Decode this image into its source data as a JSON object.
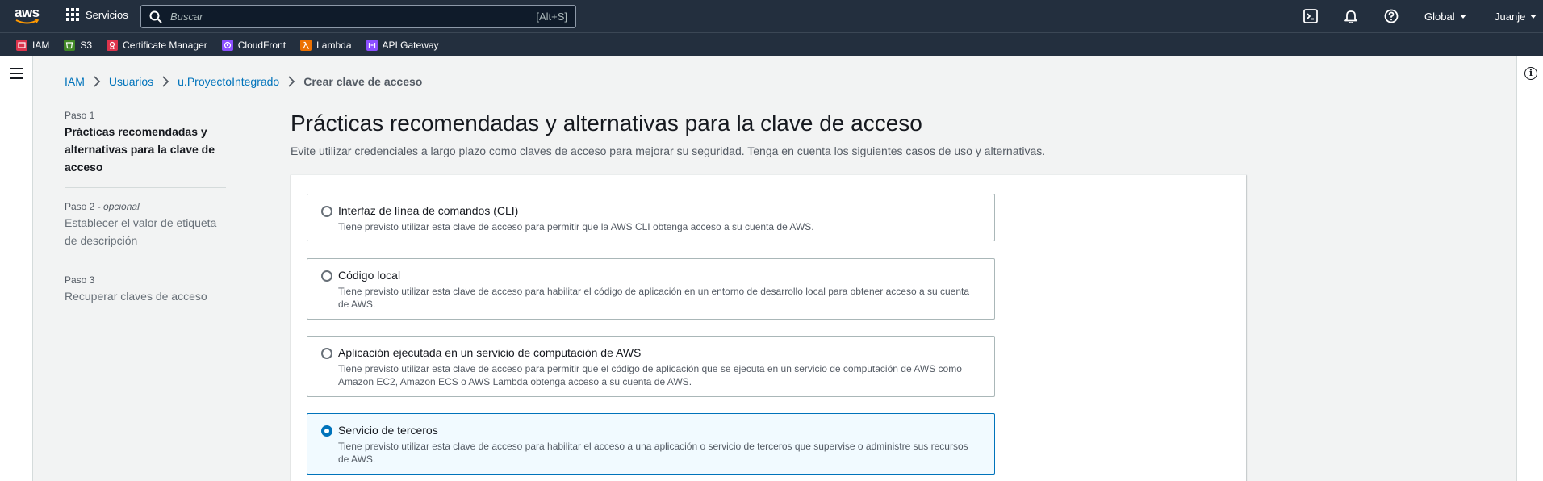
{
  "topnav": {
    "logo": "aws",
    "services_label": "Servicios",
    "search_placeholder": "Buscar",
    "search_shortcut": "[Alt+S]",
    "region": "Global",
    "user": "Juanje"
  },
  "favorites": [
    {
      "label": "IAM",
      "color": "#dd344c"
    },
    {
      "label": "S3",
      "color": "#3f8624"
    },
    {
      "label": "Certificate Manager",
      "color": "#dd344c"
    },
    {
      "label": "CloudFront",
      "color": "#8c4fff"
    },
    {
      "label": "Lambda",
      "color": "#ed7100"
    },
    {
      "label": "API Gateway",
      "color": "#8c4fff"
    }
  ],
  "breadcrumb": {
    "items": [
      "IAM",
      "Usuarios",
      "u.ProyectoIntegrado"
    ],
    "current": "Crear clave de acceso"
  },
  "steps": [
    {
      "label": "Paso 1",
      "optional": "",
      "title": "Prácticas recomendadas y alternativas para la clave de acceso"
    },
    {
      "label": "Paso 2 - ",
      "optional": "opcional",
      "title": "Establecer el valor de etiqueta de descripción"
    },
    {
      "label": "Paso 3",
      "optional": "",
      "title": "Recuperar claves de acceso"
    }
  ],
  "page": {
    "title": "Prácticas recomendadas y alternativas para la clave de acceso",
    "description": "Evite utilizar credenciales a largo plazo como claves de acceso para mejorar su seguridad. Tenga en cuenta los siguientes casos de uso y alternativas."
  },
  "options": [
    {
      "title": "Interfaz de línea de comandos (CLI)",
      "desc": "Tiene previsto utilizar esta clave de acceso para permitir que la AWS CLI obtenga acceso a su cuenta de AWS.",
      "selected": false
    },
    {
      "title": "Código local",
      "desc": "Tiene previsto utilizar esta clave de acceso para habilitar el código de aplicación en un entorno de desarrollo local para obtener acceso a su cuenta de AWS.",
      "selected": false
    },
    {
      "title": "Aplicación ejecutada en un servicio de computación de AWS",
      "desc": "Tiene previsto utilizar esta clave de acceso para permitir que el código de aplicación que se ejecuta en un servicio de computación de AWS como Amazon EC2, Amazon ECS o AWS Lambda obtenga acceso a su cuenta de AWS.",
      "selected": false
    },
    {
      "title": "Servicio de terceros",
      "desc": "Tiene previsto utilizar esta clave de acceso para habilitar el acceso a una aplicación o servicio de terceros que supervise o administre sus recursos de AWS.",
      "selected": true
    }
  ],
  "colors": {
    "nav_bg": "#232f3e",
    "link": "#0073bb",
    "selected_bg": "#f1faff"
  }
}
